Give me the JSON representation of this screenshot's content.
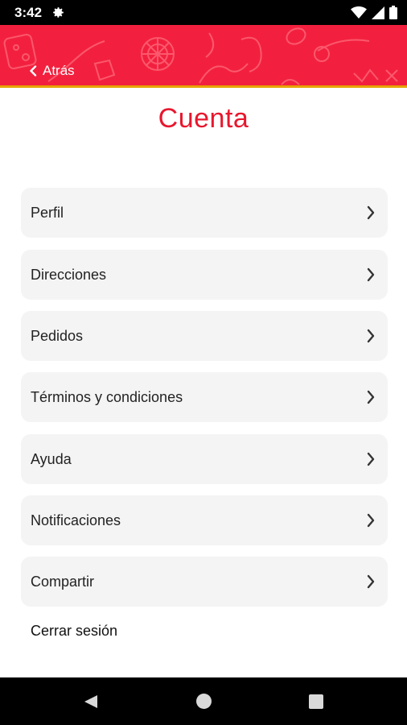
{
  "status_bar": {
    "time": "3:42"
  },
  "header": {
    "back_label": "Atrás",
    "accent_color": "#f2203e",
    "stripe_color": "#e6a300"
  },
  "page": {
    "title": "Cuenta",
    "title_color": "#e8172e"
  },
  "menu": {
    "items": [
      {
        "label": "Perfil"
      },
      {
        "label": "Direcciones"
      },
      {
        "label": "Pedidos"
      },
      {
        "label": "Términos y condiciones"
      },
      {
        "label": "Ayuda"
      },
      {
        "label": "Notificaciones"
      },
      {
        "label": "Compartir"
      }
    ]
  },
  "logout_label": "Cerrar sesión",
  "icons": {
    "status": [
      "gear-icon",
      "wifi-icon",
      "signal-icon",
      "battery-icon"
    ],
    "navigation": [
      "chevron-left-icon",
      "chevron-right-icon"
    ],
    "system_nav": [
      "back-triangle-icon",
      "home-circle-icon",
      "recents-square-icon"
    ]
  }
}
